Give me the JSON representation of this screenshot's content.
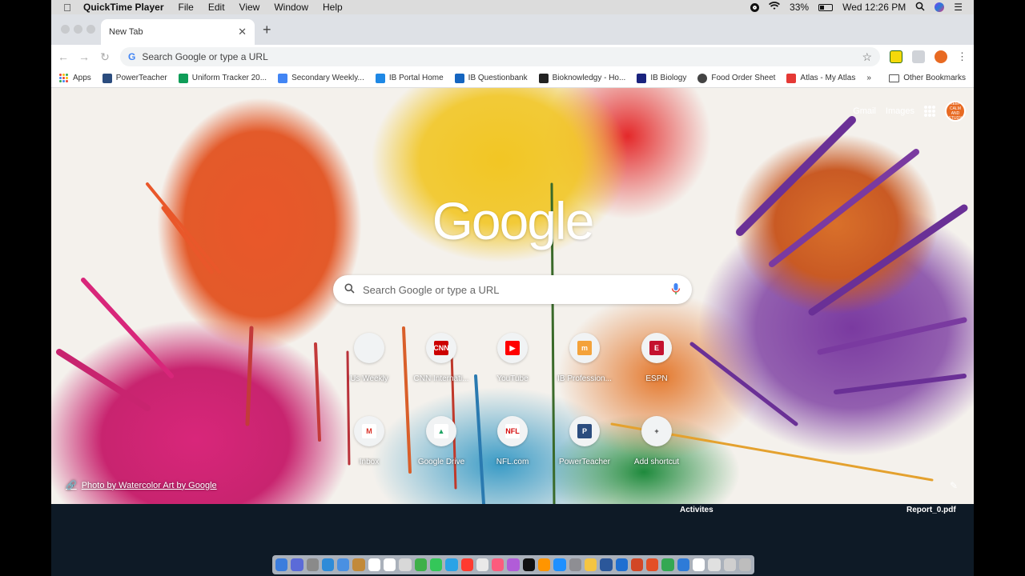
{
  "menubar": {
    "app": "QuickTime Player",
    "items": [
      "File",
      "Edit",
      "View",
      "Window",
      "Help"
    ],
    "battery": "33%",
    "clock": "Wed 12:26 PM"
  },
  "tab": {
    "title": "New Tab"
  },
  "omnibox": {
    "placeholder": "Search Google or type a URL"
  },
  "bookmarks": {
    "items": [
      {
        "label": "Apps",
        "color": "#ea4335"
      },
      {
        "label": "PowerTeacher",
        "color": "#2b4c7e"
      },
      {
        "label": "Uniform Tracker 20...",
        "color": "#0f9d58"
      },
      {
        "label": "Secondary Weekly...",
        "color": "#4285f4"
      },
      {
        "label": "IB Portal Home",
        "color": "#1e88e5"
      },
      {
        "label": "IB Questionbank",
        "color": "#1565c0"
      },
      {
        "label": "Bioknowledgy - Ho...",
        "color": "#222222"
      },
      {
        "label": "IB Biology",
        "color": "#1a237e"
      },
      {
        "label": "Food Order Sheet",
        "color": "#444444"
      },
      {
        "label": "Atlas - My Atlas",
        "color": "#e53935"
      }
    ],
    "more": "»",
    "other": "Other Bookmarks"
  },
  "ntp": {
    "gmail": "Gmail",
    "images": "Images",
    "avatar_text": "KEEP CALM AND STUDY",
    "logo": "Google",
    "search_placeholder": "Search Google or type a URL",
    "shortcuts": [
      {
        "label": "Us Weekly",
        "fav": "",
        "color": "#f1f3f4",
        "fg": "#333"
      },
      {
        "label": "CNN Internati...",
        "fav": "CNN",
        "color": "#cc0000",
        "fg": "#fff"
      },
      {
        "label": "YouTube",
        "fav": "▶",
        "color": "#ff0000",
        "fg": "#fff"
      },
      {
        "label": "IB Profession...",
        "fav": "m",
        "color": "#f4a23a",
        "fg": "#fff"
      },
      {
        "label": "ESPN",
        "fav": "E",
        "color": "#c4122f",
        "fg": "#fff"
      },
      {
        "label": "Inbox",
        "fav": "M",
        "color": "#ffffff",
        "fg": "#d93025"
      },
      {
        "label": "Google Drive",
        "fav": "▲",
        "color": "#ffffff",
        "fg": "#1fa463"
      },
      {
        "label": "NFL.com",
        "fav": "NFL",
        "color": "#ffffff",
        "fg": "#d50a0a"
      },
      {
        "label": "PowerTeacher",
        "fav": "P",
        "color": "#2b4c7e",
        "fg": "#fff"
      },
      {
        "label": "Add shortcut",
        "fav": "+",
        "color": "#f1f3f4",
        "fg": "#333"
      }
    ],
    "attribution": "Photo by Watercolor Art by Google"
  },
  "desktop": {
    "left_label": "Activites",
    "right_label": "Report_0.pdf"
  },
  "dock": {
    "colors": [
      "#3b7ddd",
      "#5b6bd8",
      "#8a8a8a",
      "#2e8bd8",
      "#4a90e2",
      "#c28a3a",
      "#ffffff",
      "#ffffff",
      "#d8d8d8",
      "#3fb04a",
      "#34c759",
      "#2aa3e6",
      "#ff3b30",
      "#e9e9e9",
      "#fc5c7d",
      "#b15cd8",
      "#111111",
      "#ff9500",
      "#1e90ff",
      "#8e8e93",
      "#f5c542",
      "#2b579a",
      "#1f6fd1",
      "#d24726",
      "#e34f26",
      "#34a853",
      "#2e7bd8",
      "#ffffff",
      "#e0e0e0",
      "#cfcfcf",
      "#bdbdbd"
    ]
  }
}
